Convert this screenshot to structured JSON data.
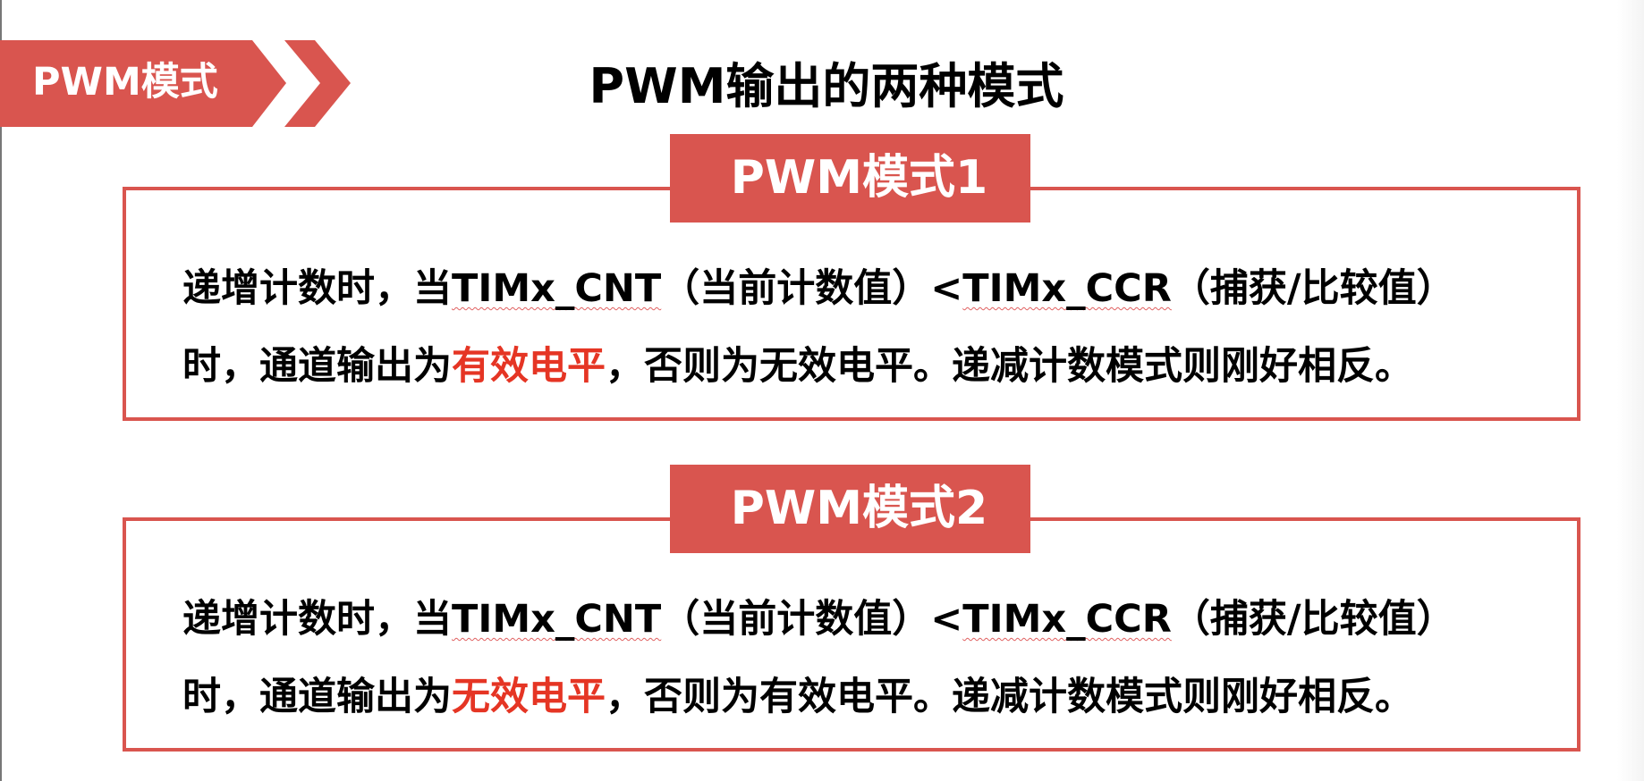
{
  "header": {
    "section_label": "PWM模式",
    "title": "PWM输出的两种模式"
  },
  "modes": [
    {
      "label": "PWM模式1",
      "line1": {
        "a": "递增计数时，当",
        "b": "TIMx_CNT",
        "c": "（当前计数值）<",
        "d": "TIMx_CCR",
        "e": "（捕获/比较值）"
      },
      "line2": {
        "before": "时，通道输出为",
        "highlight": "有效电平",
        "after": "，否则为无效电平。递减计数模式则刚好相反。"
      }
    },
    {
      "label": "PWM模式2",
      "line1": {
        "a": "递增计数时，当",
        "b": "TIMx_CNT",
        "c": "（当前计数值）<",
        "d": "TIMx_CCR",
        "e": "（捕获/比较值）"
      },
      "line2": {
        "before": "时，通道输出为",
        "highlight": "无效电平",
        "after": "，否则为有效电平。递减计数模式则刚好相反。"
      }
    }
  ],
  "colors": {
    "accent": "#d9554f",
    "highlight_text": "#e53524"
  }
}
